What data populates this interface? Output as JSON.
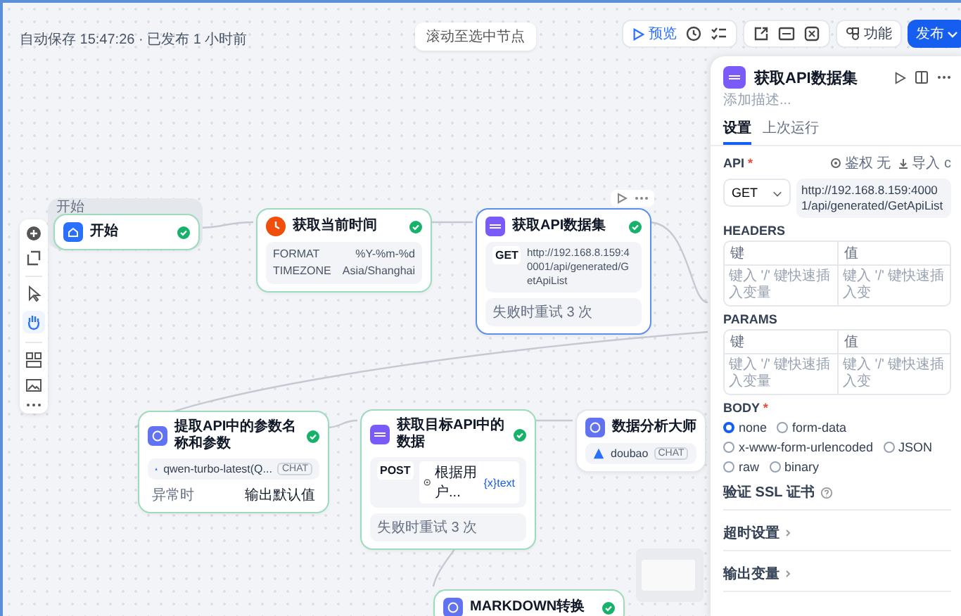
{
  "status": "自动保存 15:47:26 · 已发布 1 小时前",
  "scroll_button": "滚动至选中节点",
  "toolbar": {
    "preview": "预览",
    "features": "功能",
    "publish": "发布"
  },
  "nodes": [
    {
      "kind": "start",
      "title": "开始",
      "group_label": "开始",
      "success": true,
      "selected": false
    },
    {
      "kind": "tool",
      "title": "获取当前时间",
      "success": true,
      "selected": false,
      "params": [
        {
          "key": "FORMAT",
          "value": "%Y-%m-%d"
        },
        {
          "key": "TIMEZONE",
          "value": "Asia/Shanghai"
        }
      ]
    },
    {
      "kind": "http",
      "title": "获取API数据集",
      "success": true,
      "selected": true,
      "method": "GET",
      "url": "http://192.168.8.159:40001/api/generated/GetApiList",
      "retry": "失败时重试 3 次"
    },
    {
      "kind": "llm",
      "title": "提取API中的参数名称和参数",
      "success": true,
      "selected": false,
      "model": "qwen-turbo-latest(Q...",
      "mode": "CHAT",
      "footer_left": "异常时",
      "footer_right": "输出默认值"
    },
    {
      "kind": "http",
      "title": "获取目标API中的数据",
      "success": true,
      "selected": false,
      "method": "POST",
      "url": "根据用户...",
      "var_tag": "{x}text",
      "retry": "失败时重试 3 次"
    },
    {
      "kind": "llm",
      "title": "数据分析大师",
      "success": false,
      "selected": false,
      "model": "doubao",
      "mode": "CHAT"
    },
    {
      "kind": "llm",
      "title": "MARKDOWN转换",
      "success": true,
      "selected": false
    }
  ],
  "panel": {
    "title": "获取API数据集",
    "description_placeholder": "添加描述...",
    "tabs": [
      {
        "label": "设置",
        "selected": true
      },
      {
        "label": "上次运行",
        "selected": false
      }
    ],
    "api_label": "API",
    "required_mark": "*",
    "auth": "鉴权 无",
    "import": "导入 c",
    "method": "GET",
    "url": "http://192.168.8.159:40001/api/generated/GetApiList",
    "tables": [
      {
        "title": "HEADERS",
        "columns": [
          "键",
          "值"
        ],
        "placeholders": [
          "键入 '/' 键快速插入变量",
          "键入 '/' 键快速插入变"
        ]
      },
      {
        "title": "PARAMS",
        "columns": [
          "键",
          "值"
        ],
        "placeholders": [
          "键入 '/' 键快速插入变量",
          "键入 '/' 键快速插入变"
        ]
      }
    ],
    "body_label": "BODY",
    "body_required_mark": "*",
    "body_options": [
      {
        "label": "none",
        "selected": true
      },
      {
        "label": "form-data",
        "selected": false
      },
      {
        "label": "x-www-form-urlencoded",
        "selected": false
      },
      {
        "label": "JSON",
        "selected": false
      },
      {
        "label": "raw",
        "selected": false
      },
      {
        "label": "binary",
        "selected": false
      }
    ],
    "ssl_label": "验证 SSL 证书",
    "sections": [
      "超时设置",
      "输出变量"
    ]
  }
}
